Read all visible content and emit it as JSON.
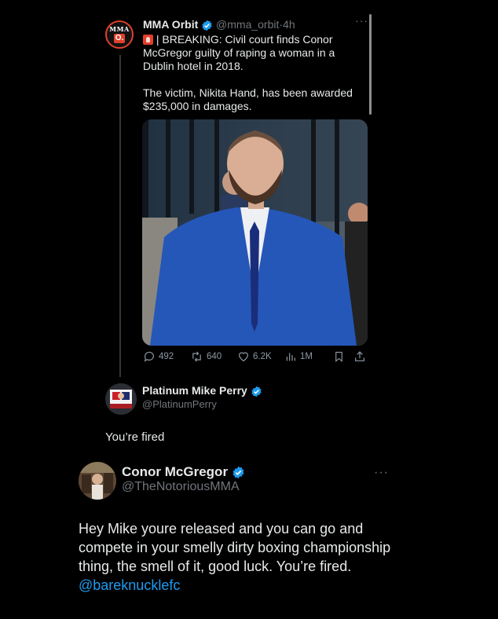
{
  "post1": {
    "author_name": "MMA Orbit",
    "author_handle": "@mma_orbit",
    "separator": "·",
    "time": "4h",
    "avatar_text_top": "MMA",
    "avatar_text_bottom": "O.",
    "line1": "| BREAKING: Civil court finds Conor McGregor guilty of raping a woman in a Dublin hotel in 2018.",
    "line2": "The victim, Nikita Hand, has been awarded $235,000 in damages.",
    "replies": "492",
    "reposts": "640",
    "likes": "6.2K",
    "views": "1M"
  },
  "post2": {
    "author_name": "Platinum Mike Perry",
    "author_handle": "@PlatinumPerry",
    "text": "You’re fired"
  },
  "post3": {
    "author_name": "Conor McGregor",
    "author_handle": "@TheNotoriousMMA",
    "text": "Hey Mike youre released and you can go and compete in your smelly dirty boxing championship thing, the smell of it, good luck. You’re fired.",
    "mention": "@bareknucklefc"
  },
  "more_label": "···",
  "icons": [
    "verified-badge-icon",
    "siren-emoji-icon",
    "reply-icon",
    "repost-icon",
    "like-icon",
    "views-icon",
    "bookmark-icon",
    "share-icon",
    "more-icon"
  ],
  "colors": {
    "background": "#000000",
    "text": "#e7e9ea",
    "muted": "#71767b",
    "accent": "#1d9bf0",
    "brand_red": "#e0402b"
  }
}
